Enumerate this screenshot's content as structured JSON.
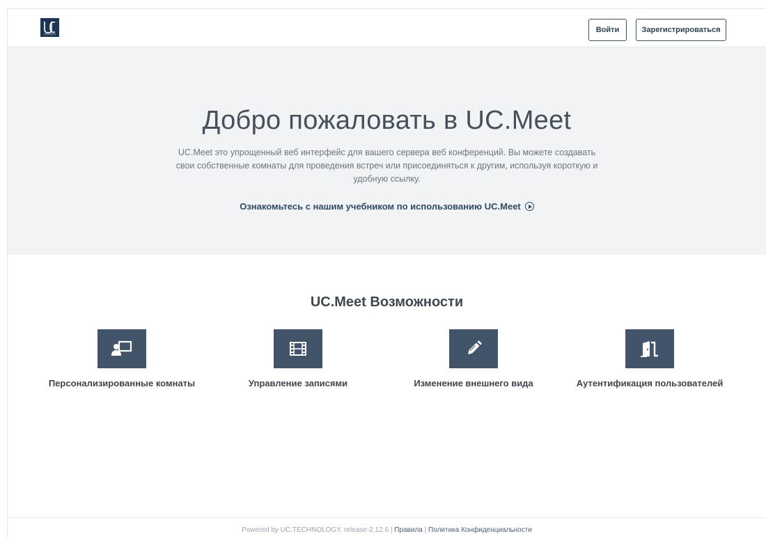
{
  "header": {
    "logo_text": "UC",
    "login_label": "Войти",
    "signup_label": "Зарегистрироваться"
  },
  "hero": {
    "title": "Добро пожаловать в UC.Meet",
    "description": "UC.Meet это упрощенный веб интерфейс для вашего сервера веб конференций. Вы можете создавать свои собственные комнаты для проведения встреч или присоединяться к другим, используя короткую и удобную ссылку.",
    "tutorial_link": "Ознакомьтесь с нашим учебником по использованию UC.Meet"
  },
  "features": {
    "title": "UC.Meet Возможности",
    "items": [
      {
        "label": "Персонализированные комнаты",
        "icon": "presentation-room-icon"
      },
      {
        "label": "Управление записями",
        "icon": "film-icon"
      },
      {
        "label": "Изменение внешнего вида",
        "icon": "pencil-icon"
      },
      {
        "label": "Аутентификация пользователей",
        "icon": "door-icon"
      }
    ]
  },
  "footer": {
    "powered_text": "Powered by UC.TECHNOLOGY. release-2.12.6 |",
    "rules_link": "Правила",
    "separator": "|",
    "privacy_link": "Политика Конфиденциальности"
  },
  "colors": {
    "accent": "#42546a",
    "hero_bg": "#f1f3f5",
    "logo_bg": "#1c3553"
  }
}
